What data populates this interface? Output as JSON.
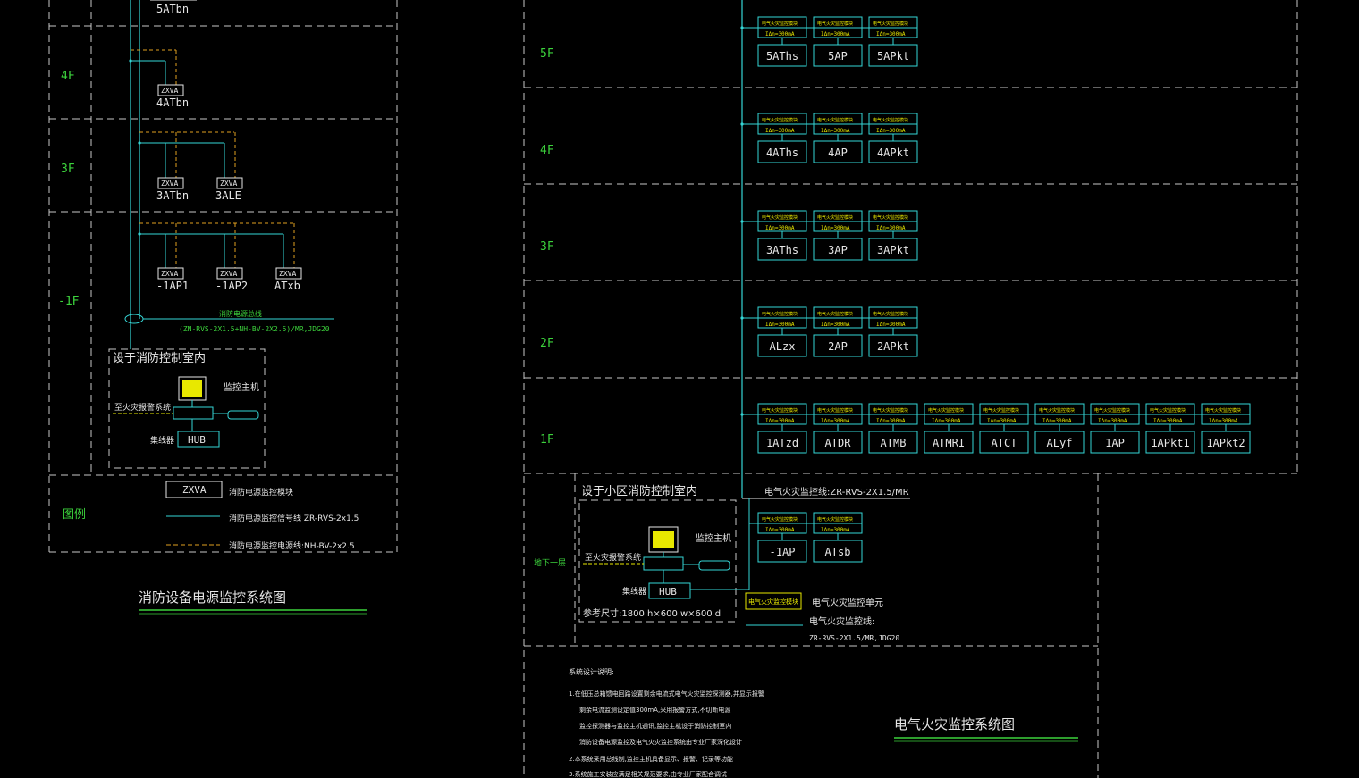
{
  "colors": {
    "background": "#000000",
    "cyan": "#35d6d6",
    "yellow": "#e8e800",
    "white": "#e6e6e6",
    "green": "#3cd23c",
    "dashed": "#c8c8c8",
    "orange_dashed": "#e0a020"
  },
  "left": {
    "floor_labels": [
      "4F",
      "3F",
      "-1F",
      "图例"
    ],
    "top_label": "5ATbn",
    "module_text": "ZXVA",
    "module_nodes": [
      {
        "name": "4ATbn"
      },
      {
        "name": "3ATbn"
      },
      {
        "name": "3ALE"
      },
      {
        "name": "-1AP1"
      },
      {
        "name": "-1AP2"
      },
      {
        "name": "ATxb"
      }
    ],
    "bus_label": "消防电源总线",
    "bus_cable": "(ZN-RVS-2X1.5+NH-BV-2X2.5)/MR,JDG20",
    "control_room_title": "设于消防控制室内",
    "host_label": "监控主机",
    "alarm_label": "至火灾报警系统",
    "hub": "HUB",
    "hub_label": "集线器",
    "legend": {
      "module": "ZXVA",
      "module_desc": "消防电源监控模块",
      "signal_desc": "消防电源监控信号线  ZR-RVS-2x1.5",
      "power_desc": "消防电源监控电源线:NH-BV-2x2.5"
    },
    "title": "消防设备电源监控系统图"
  },
  "right": {
    "floor_labels": [
      "5F",
      "4F",
      "3F",
      "2F",
      "1F",
      "地下一层"
    ],
    "module_line1": "电气火灾监控模块",
    "module_line2": "IΔn=300mA",
    "floors": [
      {
        "names": [
          "5AThs",
          "5AP",
          "5APkt"
        ]
      },
      {
        "names": [
          "4AThs",
          "4AP",
          "4APkt"
        ]
      },
      {
        "names": [
          "3AThs",
          "3AP",
          "3APkt"
        ]
      },
      {
        "names": [
          "ALzx",
          "2AP",
          "2APkt"
        ]
      },
      {
        "names": [
          "1ATzd",
          "ATDR",
          "ATMB",
          "ATMRI",
          "ATCT",
          "ALyf",
          "1AP",
          "1APkt1",
          "1APkt2"
        ]
      }
    ],
    "basement_names": [
      "-1AP",
      "ATsb"
    ],
    "bus_cable": "电气火灾监控线:ZR-RVS-2X1.5/MR",
    "control_room_title": "设于小区消防控制室内",
    "host_label": "监控主机",
    "alarm_label": "至火灾报警系统",
    "hub": "HUB",
    "hub_label": "集线器",
    "size_label": "参考尺寸:1800 h×600 w×600 d",
    "legend_box": "电气火灾监控模块",
    "legend_unit": "电气火灾监控单元",
    "legend_line": "电气火灾监控线:",
    "legend_cable": "ZR-RVS-2X1.5/MR,JDG20",
    "notes_title": "系统设计说明:",
    "notes": [
      "1.在低压总箱馈电回路设置剩余电流式电气火灾监控探测器,并显示报警",
      "剩余电流监测设定值300mA,采用报警方式,不切断电源",
      "监控探测器与监控主机通讯,监控主机设于消防控制室内",
      "消防设备电源监控及电气火灾监控系统由专业厂家深化设计",
      "2.本系统采用总线制,监控主机具备显示、报警、记录等功能",
      "3.系统施工安装应满足相关规范要求,由专业厂家配合调试"
    ],
    "title": "电气火灾监控系统图"
  }
}
